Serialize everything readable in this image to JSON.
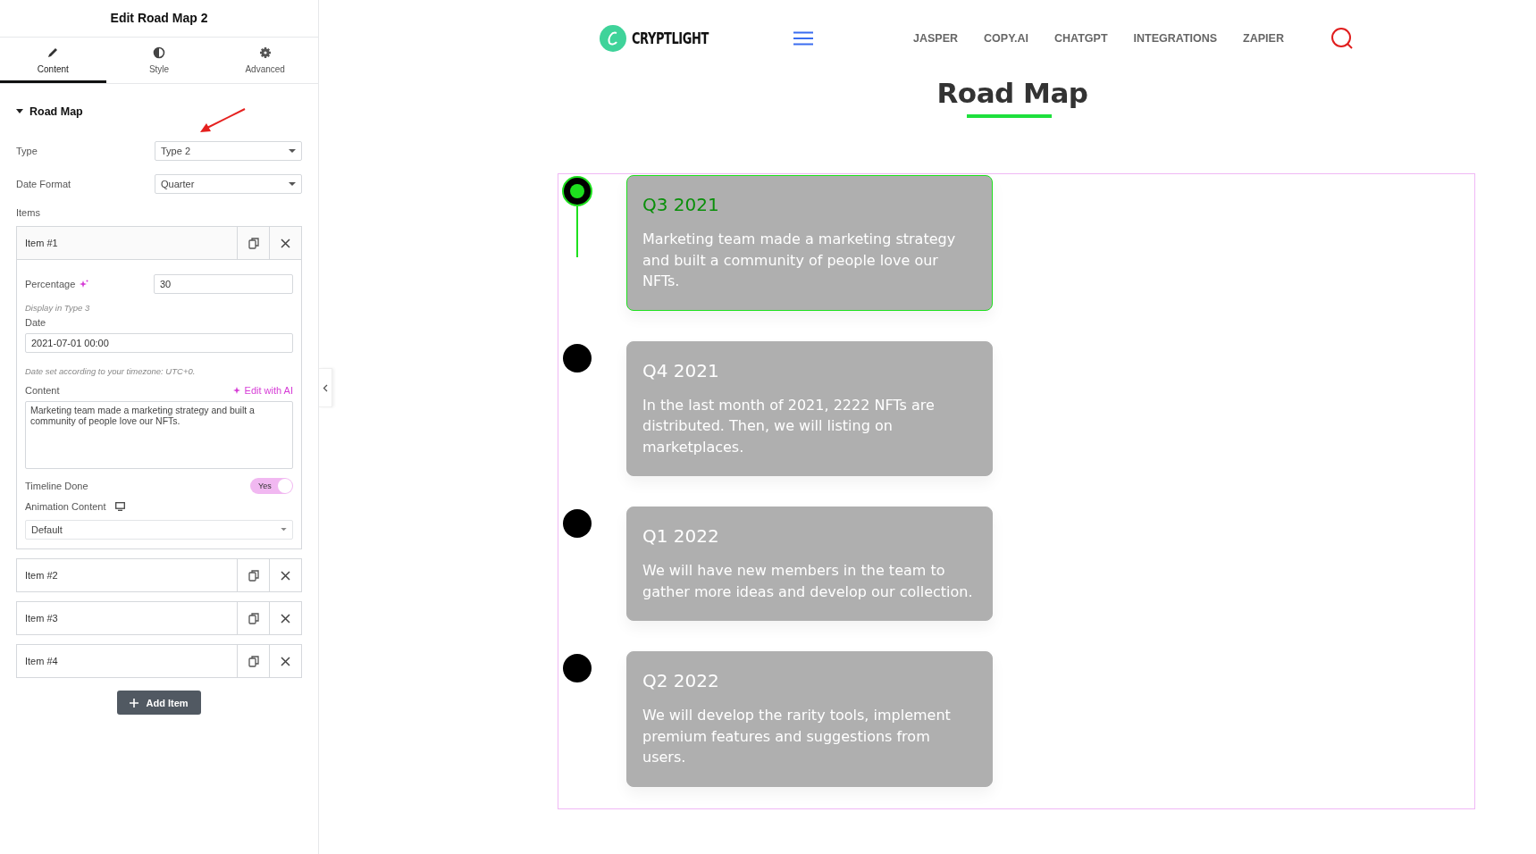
{
  "panel": {
    "title": "Edit Road Map 2",
    "tabs": [
      {
        "label": "Content",
        "selected": true
      },
      {
        "label": "Style",
        "selected": false
      },
      {
        "label": "Advanced",
        "selected": false
      }
    ],
    "section": {
      "title": "Road Map",
      "expanded": true
    },
    "type": {
      "label": "Type",
      "value": "Type 2"
    },
    "date_format": {
      "label": "Date Format",
      "value": "Quarter"
    },
    "items_label": "Items",
    "items": [
      {
        "title": "Item #1",
        "expanded": true,
        "percentage": {
          "label": "Percentage",
          "value": "30",
          "hint": "Display in Type 3"
        },
        "date": {
          "label": "Date",
          "value": "2021-07-01 00:00",
          "hint": "Date set according to your timezone: UTC+0."
        },
        "content": {
          "label": "Content",
          "ai_link": "Edit with AI",
          "value": "Marketing team made a marketing strategy and built a community of people love our NFTs."
        },
        "timeline_done": {
          "label": "Timeline Done",
          "on": true,
          "text": "Yes"
        },
        "animation": {
          "label": "Animation Content",
          "value": "Default"
        }
      },
      {
        "title": "Item #2",
        "expanded": false
      },
      {
        "title": "Item #3",
        "expanded": false
      },
      {
        "title": "Item #4",
        "expanded": false
      }
    ],
    "add_button": "Add Item"
  },
  "site": {
    "logo": "CRYPTLIGHT",
    "nav": [
      "JASPER",
      "COPY.AI",
      "CHATGPT",
      "INTEGRATIONS",
      "ZAPIER"
    ],
    "heading": "Road Map",
    "timeline": [
      {
        "date": "Q3 2021",
        "text": "Marketing team made a marketing strategy and built a community of people love our NFTs.",
        "done": true
      },
      {
        "date": "Q4 2021",
        "text": "In the last month of 2021, 2222 NFTs are distributed. Then, we will listing on marketplaces.",
        "done": false
      },
      {
        "date": "Q1 2022",
        "text": "We will have new members in the team to gather more ideas and develop our collection.",
        "done": false
      },
      {
        "date": "Q2 2022",
        "text": "We will develop the rarity tools, implement premium features and suggestions from users.",
        "done": false
      }
    ]
  }
}
